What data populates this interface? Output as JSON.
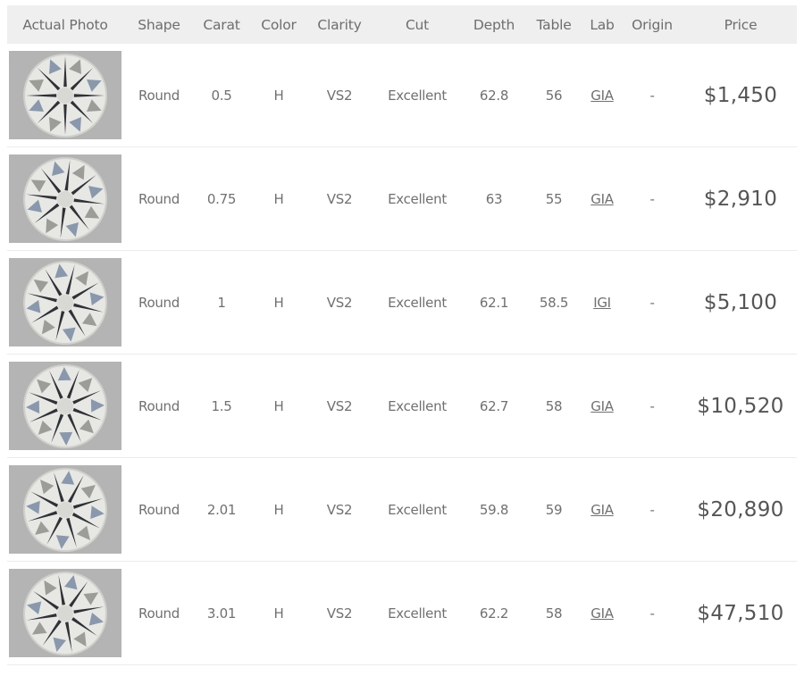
{
  "table": {
    "headers": {
      "photo": "Actual Photo",
      "shape": "Shape",
      "carat": "Carat",
      "color": "Color",
      "clarity": "Clarity",
      "cut": "Cut",
      "depth": "Depth",
      "table": "Table",
      "lab": "Lab",
      "origin": "Origin",
      "price": "Price"
    },
    "rows": [
      {
        "photo_icon": "diamond-photo",
        "shape": "Round",
        "carat": "0.5",
        "color": "H",
        "clarity": "VS2",
        "cut": "Excellent",
        "depth": "62.8",
        "table": "56",
        "lab": "GIA",
        "origin": "-",
        "price": "$1,450"
      },
      {
        "photo_icon": "diamond-photo",
        "shape": "Round",
        "carat": "0.75",
        "color": "H",
        "clarity": "VS2",
        "cut": "Excellent",
        "depth": "63",
        "table": "55",
        "lab": "GIA",
        "origin": "-",
        "price": "$2,910"
      },
      {
        "photo_icon": "diamond-photo",
        "shape": "Round",
        "carat": "1",
        "color": "H",
        "clarity": "VS2",
        "cut": "Excellent",
        "depth": "62.1",
        "table": "58.5",
        "lab": "IGI",
        "origin": "-",
        "price": "$5,100"
      },
      {
        "photo_icon": "diamond-photo",
        "shape": "Round",
        "carat": "1.5",
        "color": "H",
        "clarity": "VS2",
        "cut": "Excellent",
        "depth": "62.7",
        "table": "58",
        "lab": "GIA",
        "origin": "-",
        "price": "$10,520"
      },
      {
        "photo_icon": "diamond-photo",
        "shape": "Round",
        "carat": "2.01",
        "color": "H",
        "clarity": "VS2",
        "cut": "Excellent",
        "depth": "59.8",
        "table": "59",
        "lab": "GIA",
        "origin": "-",
        "price": "$20,890"
      },
      {
        "photo_icon": "diamond-photo",
        "shape": "Round",
        "carat": "3.01",
        "color": "H",
        "clarity": "VS2",
        "cut": "Excellent",
        "depth": "62.2",
        "table": "58",
        "lab": "GIA",
        "origin": "-",
        "price": "$47,510"
      }
    ]
  },
  "colors": {
    "header_bg": "#efefef",
    "text": "#707070",
    "price_text": "#555555",
    "photo_bg": "#b4b4b4"
  }
}
